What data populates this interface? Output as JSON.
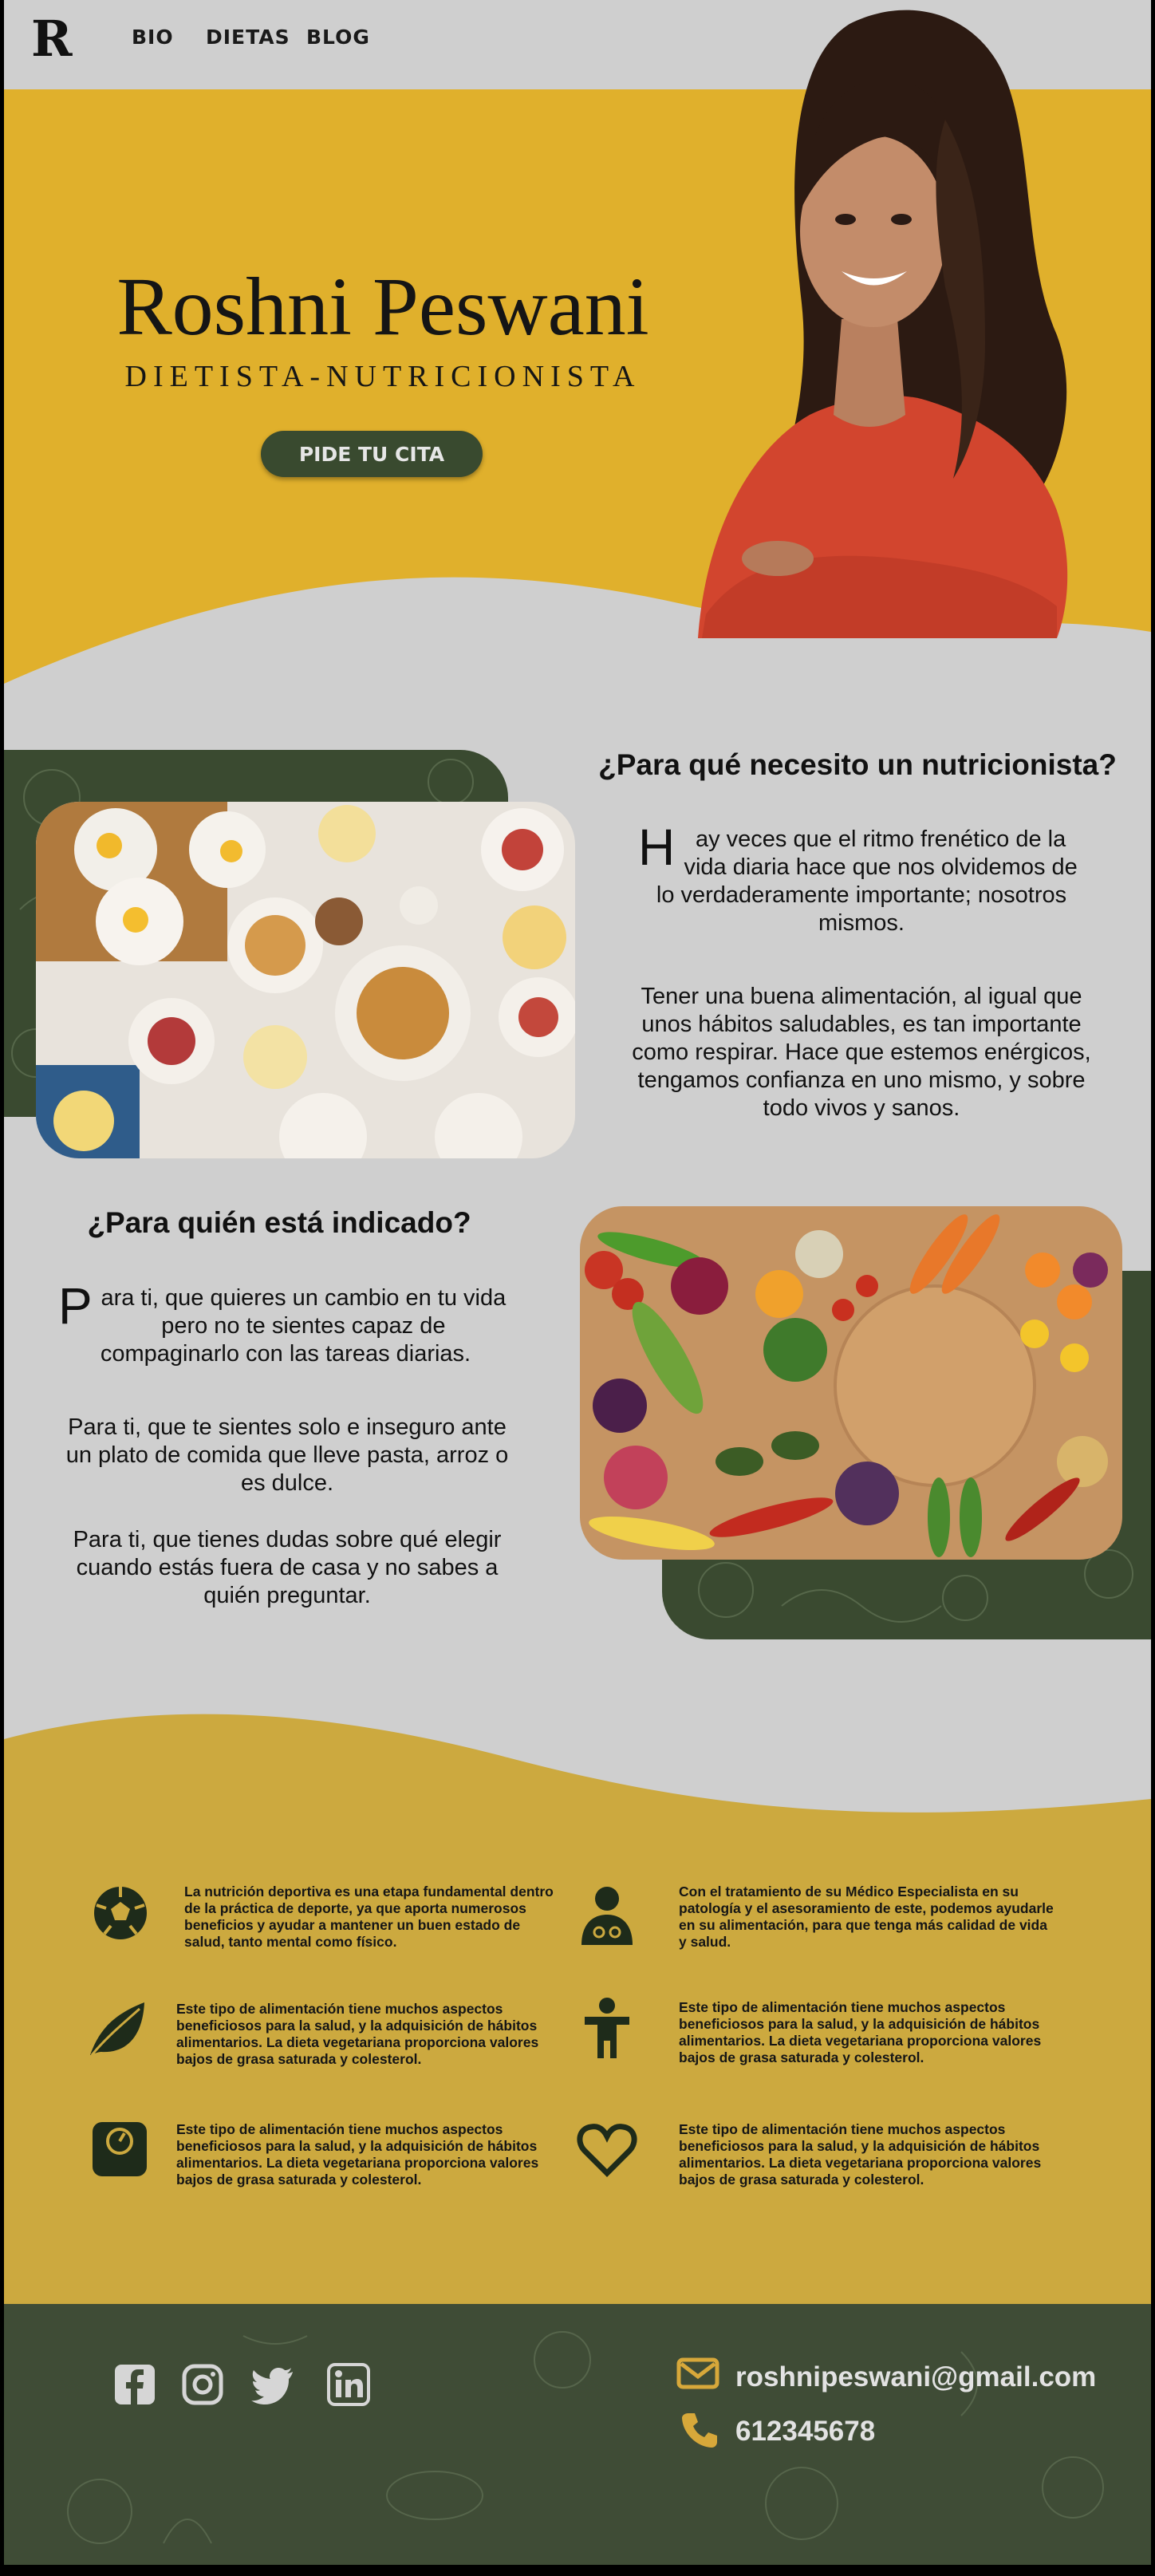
{
  "nav": {
    "logo": "R",
    "links": [
      "BIO",
      "DIETAS",
      "BLOG"
    ]
  },
  "hero": {
    "name": "Roshni Peswani",
    "subtitle": "DIETISTA-NUTRICIONISTA",
    "cta": "PIDE TU CITA"
  },
  "section_why": {
    "title": "¿Para qué necesito un nutricionista?",
    "dropcap": "H",
    "p1": "ay veces que el ritmo frenético de la vida diaria hace que nos olvidemos de lo verdaderamente importante; nosotros mismos.",
    "p2": "Tener una buena alimentación, al igual que unos hábitos saludables, es tan importante como respirar. Hace que estemos enérgicos, tengamos confianza en uno mismo, y sobre todo vivos y sanos."
  },
  "section_who": {
    "title": "¿Para quién está indicado?",
    "dropcap": "P",
    "p1": "ara ti, que quieres un cambio en tu vida pero no te sientes capaz de compaginarlo con las tareas diarias.",
    "p2": "Para ti, que te sientes solo e inseguro ante un plato de comida que lleve pasta, arroz o es dulce.",
    "p3": "Para ti, que tienes dudas sobre qué elegir cuando estás fuera de casa y no sabes a quién preguntar."
  },
  "services": [
    {
      "icon": "soccer-ball-icon",
      "text": "La nutrición deportiva es una etapa fundamental dentro de la práctica de deporte, ya que aporta numerosos beneficios y ayudar a mantener un buen estado de salud, tanto mental como físico."
    },
    {
      "icon": "doctor-icon",
      "text": "Con el tratamiento de su Médico Especialista en su patología y el asesoramiento de este, podemos ayudarle en su alimentación, para que tenga más calidad de vida y salud."
    },
    {
      "icon": "leaf-icon",
      "text": "Este tipo de alimentación tiene muchos aspectos beneficiosos para la salud, y la adquisición de hábitos alimentarios. La dieta vegetariana proporciona valores bajos de grasa saturada y colesterol."
    },
    {
      "icon": "child-icon",
      "text": "Este tipo de alimentación tiene muchos aspectos beneficiosos para la salud, y la adquisición de hábitos alimentarios. La dieta vegetariana proporciona valores bajos de grasa saturada y colesterol."
    },
    {
      "icon": "scale-icon",
      "text": "Este tipo de alimentación tiene muchos aspectos beneficiosos para la salud, y la adquisición de hábitos alimentarios. La dieta vegetariana proporciona valores bajos de grasa saturada y colesterol."
    },
    {
      "icon": "heart-icon",
      "text": "Este tipo de alimentación tiene muchos aspectos beneficiosos para la salud, y la adquisición de hábitos alimentarios. La dieta vegetariana proporciona valores bajos de grasa saturada y colesterol."
    }
  ],
  "footer": {
    "social": [
      "facebook-icon",
      "instagram-icon",
      "twitter-icon",
      "linkedin-icon"
    ],
    "email": "roshnipeswani@gmail.com",
    "phone": "612345678"
  },
  "colors": {
    "background": "#cfcfcf",
    "mustard": "#cca93f",
    "hero_yellow": "#e2b227",
    "dark_green": "#3a4a30",
    "accent_gold": "#d7a83a"
  }
}
